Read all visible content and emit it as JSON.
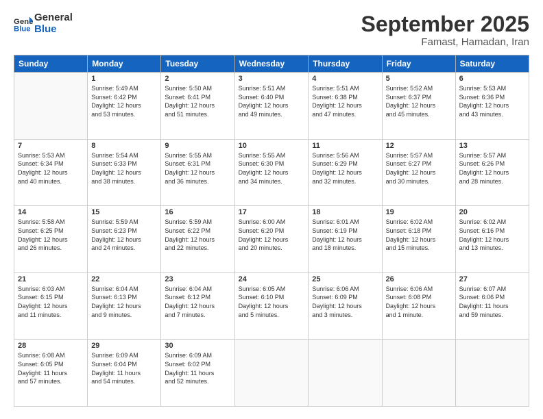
{
  "header": {
    "logo_general": "General",
    "logo_blue": "Blue",
    "month_title": "September 2025",
    "location": "Famast, Hamadan, Iran"
  },
  "days_of_week": [
    "Sunday",
    "Monday",
    "Tuesday",
    "Wednesday",
    "Thursday",
    "Friday",
    "Saturday"
  ],
  "weeks": [
    [
      {
        "day": "",
        "info": ""
      },
      {
        "day": "1",
        "info": "Sunrise: 5:49 AM\nSunset: 6:42 PM\nDaylight: 12 hours\nand 53 minutes."
      },
      {
        "day": "2",
        "info": "Sunrise: 5:50 AM\nSunset: 6:41 PM\nDaylight: 12 hours\nand 51 minutes."
      },
      {
        "day": "3",
        "info": "Sunrise: 5:51 AM\nSunset: 6:40 PM\nDaylight: 12 hours\nand 49 minutes."
      },
      {
        "day": "4",
        "info": "Sunrise: 5:51 AM\nSunset: 6:38 PM\nDaylight: 12 hours\nand 47 minutes."
      },
      {
        "day": "5",
        "info": "Sunrise: 5:52 AM\nSunset: 6:37 PM\nDaylight: 12 hours\nand 45 minutes."
      },
      {
        "day": "6",
        "info": "Sunrise: 5:53 AM\nSunset: 6:36 PM\nDaylight: 12 hours\nand 43 minutes."
      }
    ],
    [
      {
        "day": "7",
        "info": "Sunrise: 5:53 AM\nSunset: 6:34 PM\nDaylight: 12 hours\nand 40 minutes."
      },
      {
        "day": "8",
        "info": "Sunrise: 5:54 AM\nSunset: 6:33 PM\nDaylight: 12 hours\nand 38 minutes."
      },
      {
        "day": "9",
        "info": "Sunrise: 5:55 AM\nSunset: 6:31 PM\nDaylight: 12 hours\nand 36 minutes."
      },
      {
        "day": "10",
        "info": "Sunrise: 5:55 AM\nSunset: 6:30 PM\nDaylight: 12 hours\nand 34 minutes."
      },
      {
        "day": "11",
        "info": "Sunrise: 5:56 AM\nSunset: 6:29 PM\nDaylight: 12 hours\nand 32 minutes."
      },
      {
        "day": "12",
        "info": "Sunrise: 5:57 AM\nSunset: 6:27 PM\nDaylight: 12 hours\nand 30 minutes."
      },
      {
        "day": "13",
        "info": "Sunrise: 5:57 AM\nSunset: 6:26 PM\nDaylight: 12 hours\nand 28 minutes."
      }
    ],
    [
      {
        "day": "14",
        "info": "Sunrise: 5:58 AM\nSunset: 6:25 PM\nDaylight: 12 hours\nand 26 minutes."
      },
      {
        "day": "15",
        "info": "Sunrise: 5:59 AM\nSunset: 6:23 PM\nDaylight: 12 hours\nand 24 minutes."
      },
      {
        "day": "16",
        "info": "Sunrise: 5:59 AM\nSunset: 6:22 PM\nDaylight: 12 hours\nand 22 minutes."
      },
      {
        "day": "17",
        "info": "Sunrise: 6:00 AM\nSunset: 6:20 PM\nDaylight: 12 hours\nand 20 minutes."
      },
      {
        "day": "18",
        "info": "Sunrise: 6:01 AM\nSunset: 6:19 PM\nDaylight: 12 hours\nand 18 minutes."
      },
      {
        "day": "19",
        "info": "Sunrise: 6:02 AM\nSunset: 6:18 PM\nDaylight: 12 hours\nand 15 minutes."
      },
      {
        "day": "20",
        "info": "Sunrise: 6:02 AM\nSunset: 6:16 PM\nDaylight: 12 hours\nand 13 minutes."
      }
    ],
    [
      {
        "day": "21",
        "info": "Sunrise: 6:03 AM\nSunset: 6:15 PM\nDaylight: 12 hours\nand 11 minutes."
      },
      {
        "day": "22",
        "info": "Sunrise: 6:04 AM\nSunset: 6:13 PM\nDaylight: 12 hours\nand 9 minutes."
      },
      {
        "day": "23",
        "info": "Sunrise: 6:04 AM\nSunset: 6:12 PM\nDaylight: 12 hours\nand 7 minutes."
      },
      {
        "day": "24",
        "info": "Sunrise: 6:05 AM\nSunset: 6:10 PM\nDaylight: 12 hours\nand 5 minutes."
      },
      {
        "day": "25",
        "info": "Sunrise: 6:06 AM\nSunset: 6:09 PM\nDaylight: 12 hours\nand 3 minutes."
      },
      {
        "day": "26",
        "info": "Sunrise: 6:06 AM\nSunset: 6:08 PM\nDaylight: 12 hours\nand 1 minute."
      },
      {
        "day": "27",
        "info": "Sunrise: 6:07 AM\nSunset: 6:06 PM\nDaylight: 11 hours\nand 59 minutes."
      }
    ],
    [
      {
        "day": "28",
        "info": "Sunrise: 6:08 AM\nSunset: 6:05 PM\nDaylight: 11 hours\nand 57 minutes."
      },
      {
        "day": "29",
        "info": "Sunrise: 6:09 AM\nSunset: 6:04 PM\nDaylight: 11 hours\nand 54 minutes."
      },
      {
        "day": "30",
        "info": "Sunrise: 6:09 AM\nSunset: 6:02 PM\nDaylight: 11 hours\nand 52 minutes."
      },
      {
        "day": "",
        "info": ""
      },
      {
        "day": "",
        "info": ""
      },
      {
        "day": "",
        "info": ""
      },
      {
        "day": "",
        "info": ""
      }
    ]
  ]
}
